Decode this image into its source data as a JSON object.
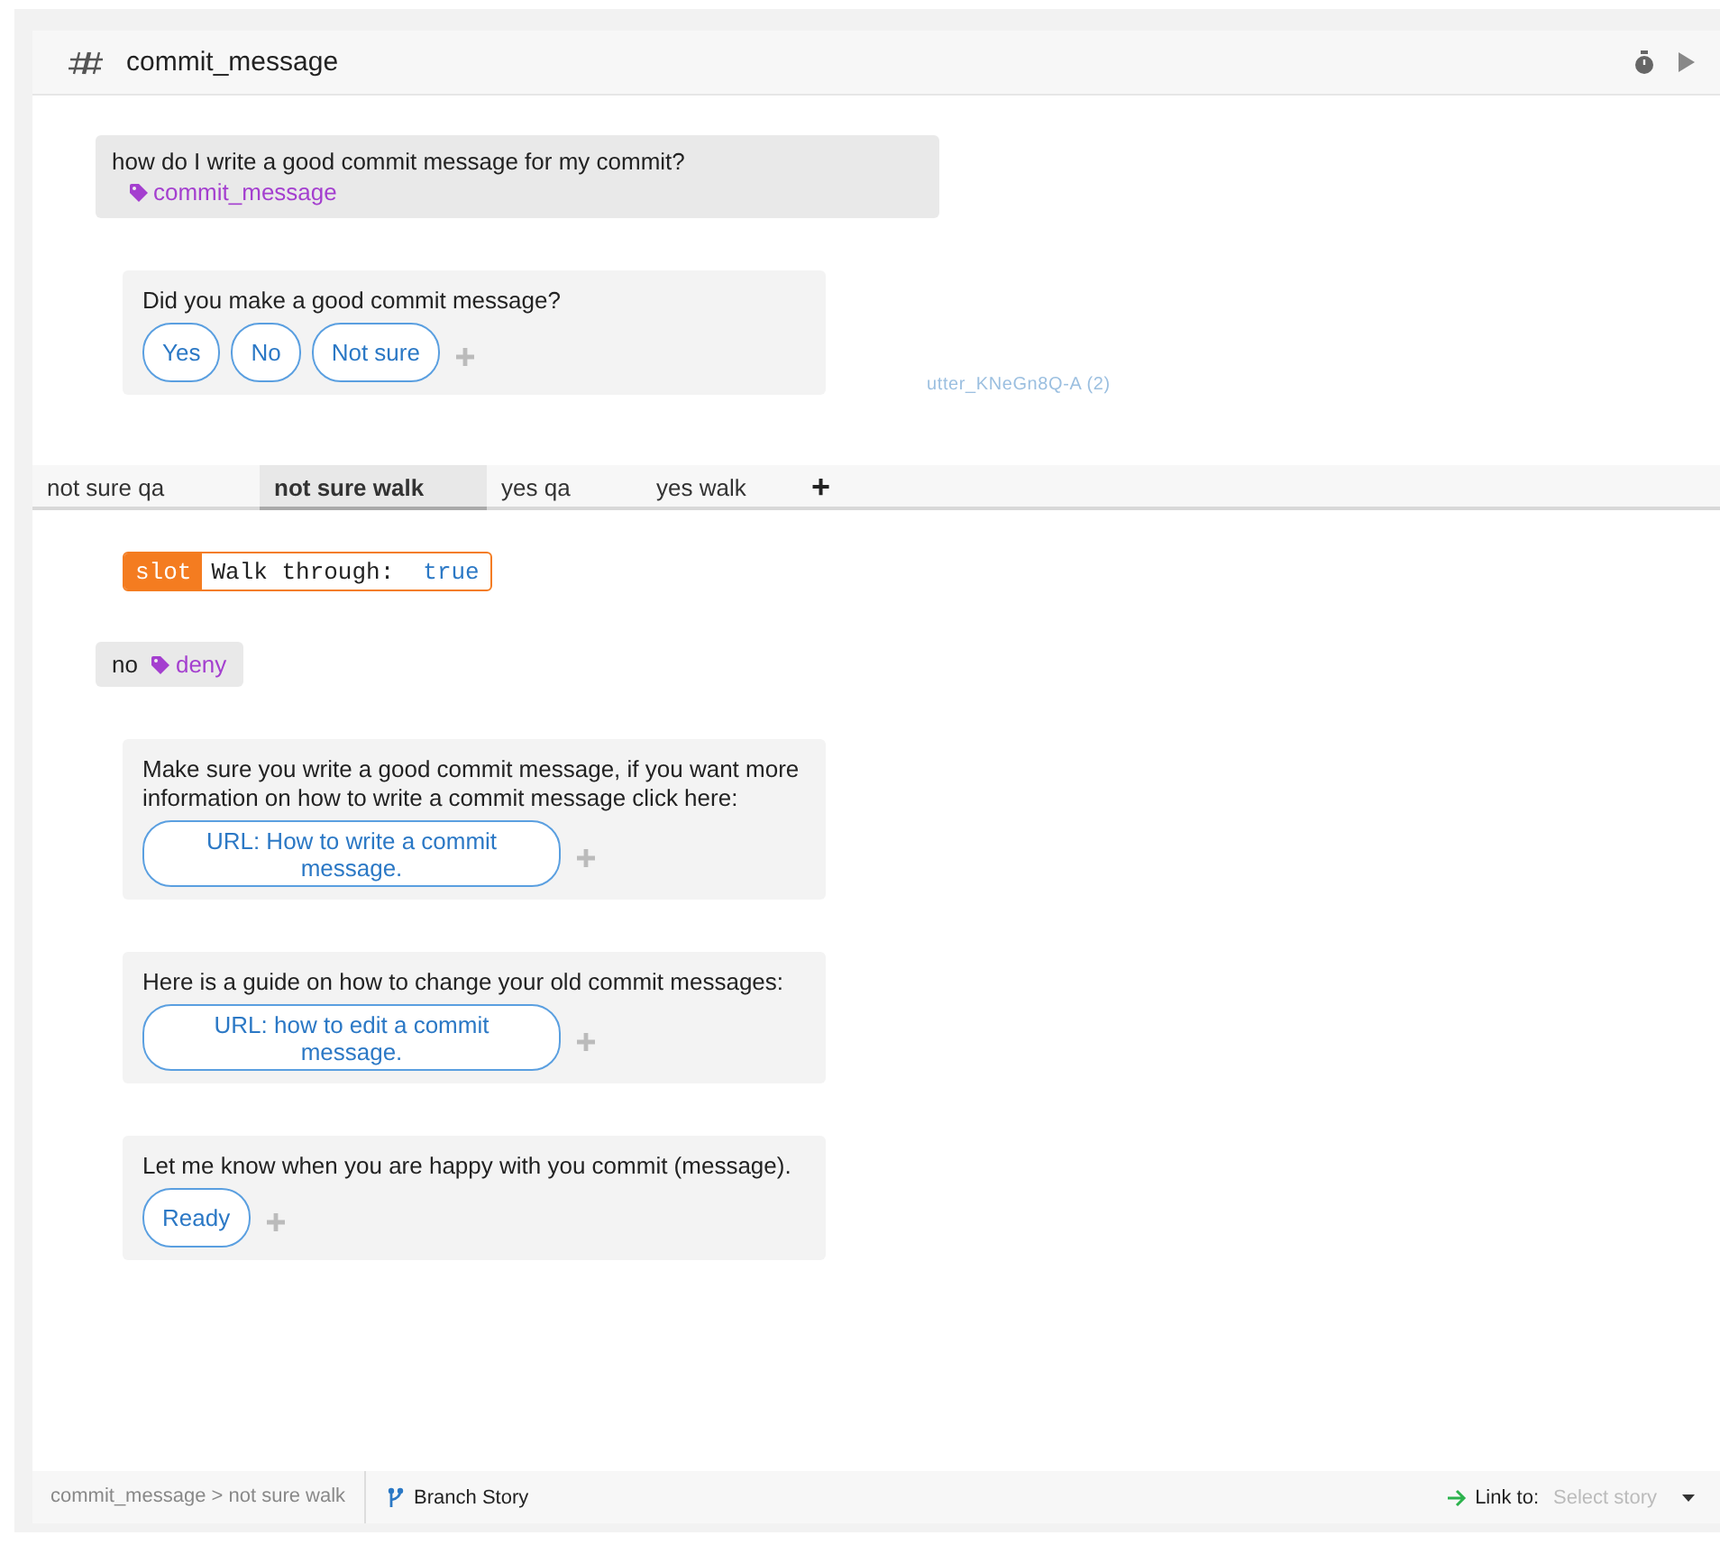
{
  "story": {
    "title": "commit_message"
  },
  "user_message": {
    "text": "how do I write a good commit message for my commit?",
    "intent": "commit_message"
  },
  "bot_message": {
    "text": "Did you make a good commit message?",
    "buttons": [
      "Yes",
      "No",
      "Not sure"
    ]
  },
  "utter_label": "utter_KNeGn8Q-A (2)",
  "branch_tabs": [
    {
      "label": "not sure qa",
      "selected": false
    },
    {
      "label": "not sure walk",
      "selected": true
    },
    {
      "label": "yes qa",
      "selected": false
    },
    {
      "label": "yes walk",
      "selected": false
    }
  ],
  "add_branch": "+",
  "branch": {
    "slot": {
      "tag": "slot",
      "name": "Walk through:",
      "value": "true"
    },
    "user_message": {
      "text": "no",
      "intent": "deny"
    },
    "bot_messages": [
      {
        "text": "Make sure you write a good commit message, if you want more information on how to write a commit message click here:",
        "buttons": [
          "URL: How to write a commit message."
        ]
      },
      {
        "text": "Here is a guide on how to change your old commit messages:",
        "buttons": [
          "URL: how to edit a commit message."
        ]
      },
      {
        "text": "Let me know  when you are happy with you commit (message).",
        "buttons": [
          "Ready"
        ]
      }
    ]
  },
  "footer": {
    "breadcrumb": "commit_message > not sure walk",
    "branch_button": "Branch Story",
    "link_label": "Link to:",
    "select_placeholder": "Select story"
  }
}
